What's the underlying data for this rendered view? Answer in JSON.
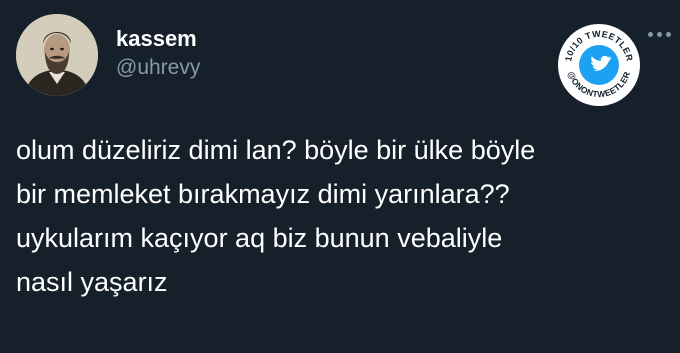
{
  "tweet": {
    "author": {
      "display_name": "kassem",
      "handle": "@uhrevy"
    },
    "lines": [
      "olum düzeliriz dimi lan? böyle bir ülke böyle",
      "bir memleket bırakmayız dimi yarınlara??",
      "uykularım kaçıyor aq biz bunun vebaliyle",
      "nasıl yaşarız"
    ]
  },
  "watermark": {
    "top_text": "10/10 TWEETLER",
    "bottom_text": "@ONONTWEETLER",
    "icon": "twitter-bird-icon",
    "accent": "#1da1f2"
  },
  "more_icon": "more-dots-icon",
  "colors": {
    "background": "#15202b",
    "primary_text": "#ffffff",
    "secondary_text": "#8899a6"
  }
}
